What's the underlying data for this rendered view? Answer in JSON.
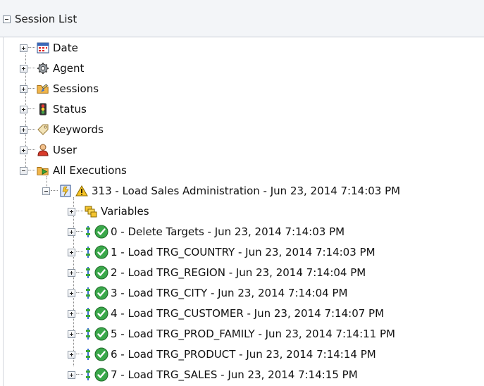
{
  "panel": {
    "title": "Session List"
  },
  "tree": {
    "top_items": [
      {
        "label": "Date",
        "icon": "calendar-icon"
      },
      {
        "label": "Agent",
        "icon": "gear-icon"
      },
      {
        "label": "Sessions",
        "icon": "folder-sessions-icon"
      },
      {
        "label": "Status",
        "icon": "traffic-light-icon"
      },
      {
        "label": "Keywords",
        "icon": "tag-icon"
      },
      {
        "label": "User",
        "icon": "user-icon"
      },
      {
        "label": "All Executions",
        "icon": "folder-run-icon"
      }
    ],
    "session": {
      "label": "313 - Load Sales Administration - Jun 23, 2014 7:14:03 PM",
      "status": "warning-icon"
    },
    "variables": {
      "label": "Variables"
    },
    "steps": [
      {
        "label": "0 - Delete Targets - Jun 23, 2014 7:14:03 PM"
      },
      {
        "label": "1 - Load TRG_COUNTRY - Jun 23, 2014 7:14:03 PM"
      },
      {
        "label": "2 - Load TRG_REGION - Jun 23, 2014 7:14:04 PM"
      },
      {
        "label": "3 - Load TRG_CITY - Jun 23, 2014 7:14:04 PM"
      },
      {
        "label": "4 - Load TRG_CUSTOMER - Jun 23, 2014 7:14:07 PM"
      },
      {
        "label": "5 - Load TRG_PROD_FAMILY - Jun 23, 2014 7:14:11 PM"
      },
      {
        "label": "6 - Load TRG_PRODUCT - Jun 23, 2014 7:14:14 PM"
      },
      {
        "label": "7 - Load TRG_SALES - Jun 23, 2014 7:14:15 PM"
      }
    ]
  }
}
